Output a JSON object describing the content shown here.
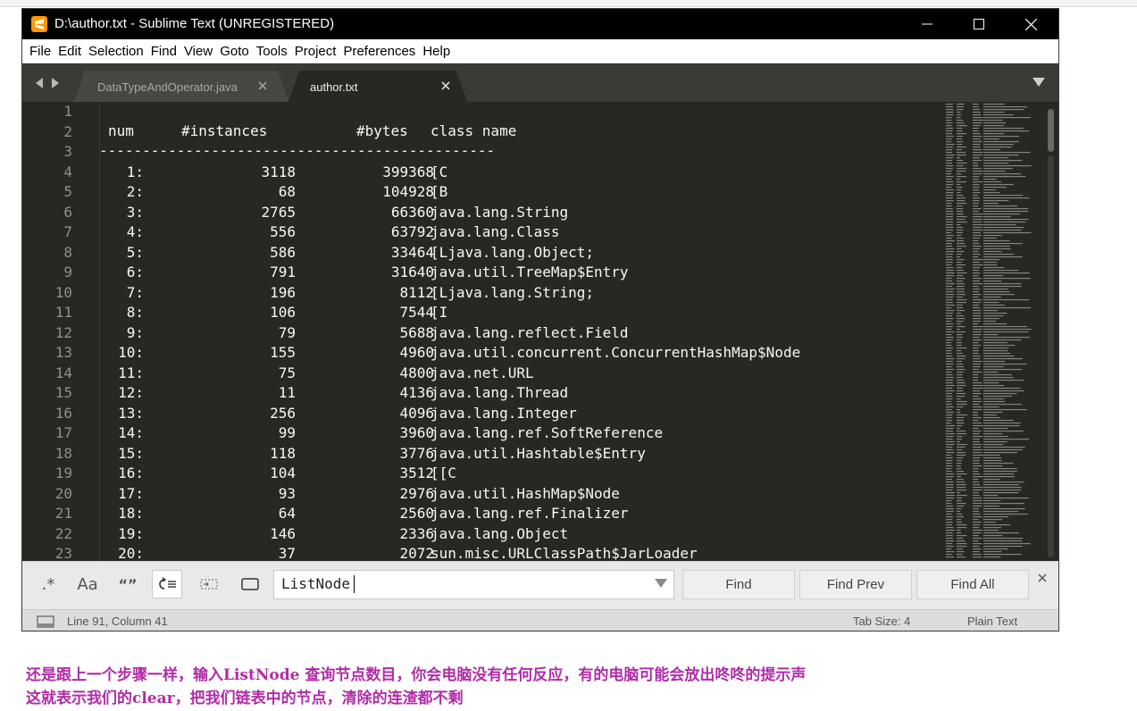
{
  "window": {
    "title": "D:\\author.txt - Sublime Text (UNREGISTERED)"
  },
  "menu": [
    "File",
    "Edit",
    "Selection",
    "Find",
    "View",
    "Goto",
    "Tools",
    "Project",
    "Preferences",
    "Help"
  ],
  "tabs": [
    {
      "label": "DataTypeAndOperator.java",
      "active": false
    },
    {
      "label": "author.txt",
      "active": true
    }
  ],
  "editor": {
    "header": {
      "num": "num",
      "instances": "#instances",
      "bytes": "#bytes",
      "class": "class name"
    },
    "separator": "----------------------------------------------",
    "rows": [
      {
        "line": "4",
        "num": "1:",
        "instances": "3118",
        "bytes": "399368",
        "class": "[C"
      },
      {
        "line": "5",
        "num": "2:",
        "instances": "68",
        "bytes": "104928",
        "class": "[B"
      },
      {
        "line": "6",
        "num": "3:",
        "instances": "2765",
        "bytes": "66360",
        "class": "java.lang.String"
      },
      {
        "line": "7",
        "num": "4:",
        "instances": "556",
        "bytes": "63792",
        "class": "java.lang.Class"
      },
      {
        "line": "8",
        "num": "5:",
        "instances": "586",
        "bytes": "33464",
        "class": "[Ljava.lang.Object;"
      },
      {
        "line": "9",
        "num": "6:",
        "instances": "791",
        "bytes": "31640",
        "class": "java.util.TreeMap$Entry"
      },
      {
        "line": "10",
        "num": "7:",
        "instances": "196",
        "bytes": "8112",
        "class": "[Ljava.lang.String;"
      },
      {
        "line": "11",
        "num": "8:",
        "instances": "106",
        "bytes": "7544",
        "class": "[I"
      },
      {
        "line": "12",
        "num": "9:",
        "instances": "79",
        "bytes": "5688",
        "class": "java.lang.reflect.Field"
      },
      {
        "line": "13",
        "num": "10:",
        "instances": "155",
        "bytes": "4960",
        "class": "java.util.concurrent.ConcurrentHashMap$Node"
      },
      {
        "line": "14",
        "num": "11:",
        "instances": "75",
        "bytes": "4800",
        "class": "java.net.URL"
      },
      {
        "line": "15",
        "num": "12:",
        "instances": "11",
        "bytes": "4136",
        "class": "java.lang.Thread"
      },
      {
        "line": "16",
        "num": "13:",
        "instances": "256",
        "bytes": "4096",
        "class": "java.lang.Integer"
      },
      {
        "line": "17",
        "num": "14:",
        "instances": "99",
        "bytes": "3960",
        "class": "java.lang.ref.SoftReference"
      },
      {
        "line": "18",
        "num": "15:",
        "instances": "118",
        "bytes": "3776",
        "class": "java.util.Hashtable$Entry"
      },
      {
        "line": "19",
        "num": "16:",
        "instances": "104",
        "bytes": "3512",
        "class": "[[C"
      },
      {
        "line": "20",
        "num": "17:",
        "instances": "93",
        "bytes": "2976",
        "class": "java.util.HashMap$Node"
      },
      {
        "line": "21",
        "num": "18:",
        "instances": "64",
        "bytes": "2560",
        "class": "java.lang.ref.Finalizer"
      },
      {
        "line": "22",
        "num": "19:",
        "instances": "146",
        "bytes": "2336",
        "class": "java.lang.Object"
      },
      {
        "line": "23",
        "num": "20:",
        "instances": "37",
        "bytes": "2072",
        "class": "sun.misc.URLClassPath$JarLoader"
      }
    ],
    "line_numbers": [
      "1",
      "2",
      "3",
      "4",
      "5",
      "6",
      "7",
      "8",
      "9",
      "10",
      "11",
      "12",
      "13",
      "14",
      "15",
      "16",
      "17",
      "18",
      "19",
      "20",
      "21",
      "22",
      "23"
    ]
  },
  "findbar": {
    "regex_label": ".*",
    "case_label": "Aa",
    "word_label": "“”",
    "query": "ListNode",
    "find_label": "Find",
    "find_prev_label": "Find Prev",
    "find_all_label": "Find All"
  },
  "status": {
    "position": "Line 91, Column 41",
    "tab_size": "Tab Size: 4",
    "syntax": "Plain Text"
  },
  "caption": {
    "line1": "还是跟上一个步骤一样，输入ListNode 查询节点数目，你会电脑没有任何反应，有的电脑可能会放出咚咚的提示声",
    "line2": "这就表示我们的clear，把我们链表中的节点，清除的连渣都不剩"
  },
  "colors": {
    "editor_bg": "#272822",
    "text": "#f8f8f2",
    "gutter_text": "#8f908a",
    "caption": "#b02ca8",
    "app_icon": "#ff9800"
  }
}
